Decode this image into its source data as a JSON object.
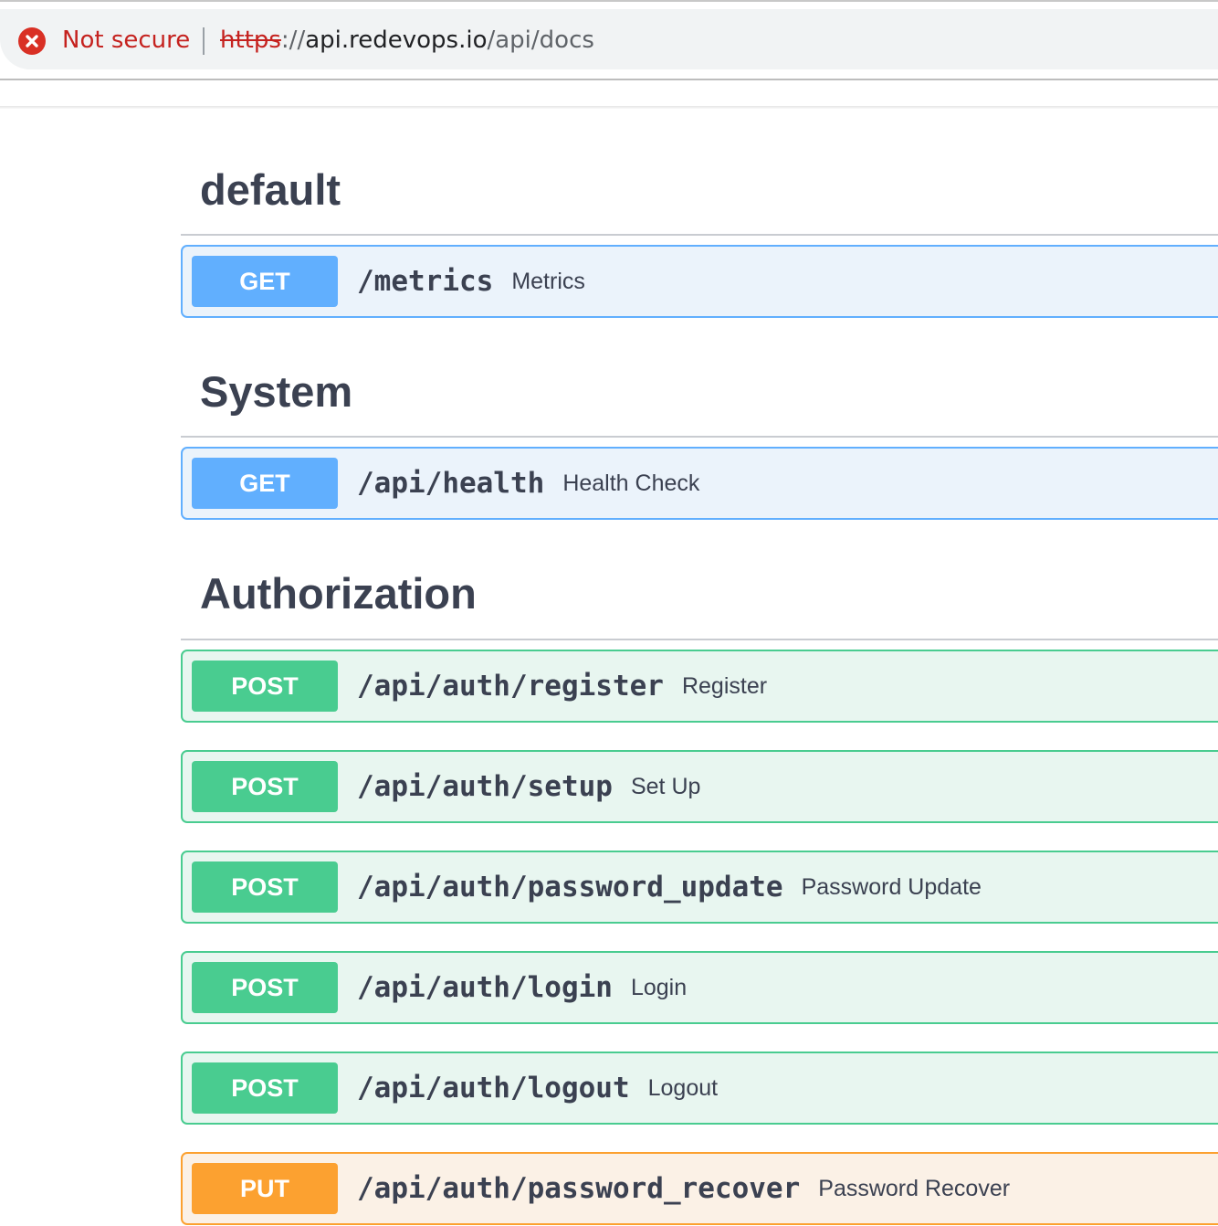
{
  "browser": {
    "security_label": "Not secure",
    "url": {
      "scheme": "https",
      "separator": "://",
      "host": "api.redevops.io",
      "path": "/api/docs"
    },
    "security_icon": "error-circle-x-icon",
    "security_color": "#c5221f"
  },
  "colors": {
    "get": "#61affe",
    "post": "#49cc90",
    "put": "#fca130",
    "text": "#3b4151"
  },
  "sections": [
    {
      "title": "default",
      "operations": [
        {
          "method": "GET",
          "path": "/metrics",
          "summary": "Metrics"
        }
      ]
    },
    {
      "title": "System",
      "operations": [
        {
          "method": "GET",
          "path": "/api/health",
          "summary": "Health Check"
        }
      ]
    },
    {
      "title": "Authorization",
      "operations": [
        {
          "method": "POST",
          "path": "/api/auth/register",
          "summary": "Register"
        },
        {
          "method": "POST",
          "path": "/api/auth/setup",
          "summary": "Set Up"
        },
        {
          "method": "POST",
          "path": "/api/auth/password_update",
          "summary": "Password Update"
        },
        {
          "method": "POST",
          "path": "/api/auth/login",
          "summary": "Login"
        },
        {
          "method": "POST",
          "path": "/api/auth/logout",
          "summary": "Logout"
        },
        {
          "method": "PUT",
          "path": "/api/auth/password_recover",
          "summary": "Password Recover"
        }
      ]
    }
  ]
}
